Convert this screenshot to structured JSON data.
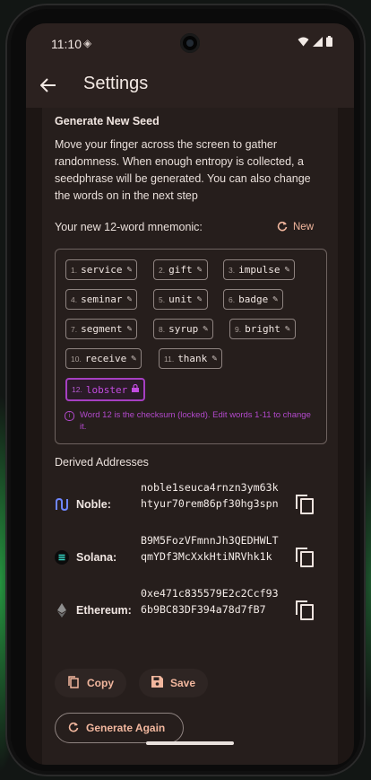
{
  "status_bar": {
    "time": "11:10"
  },
  "app_bar": {
    "title": "Settings"
  },
  "seed": {
    "heading": "Generate New Seed",
    "description": "Move your finger across the screen to gather randomness. When enough entropy is collected, a seedphrase will be generated. You can also change the words on in the next step",
    "mnemonic_label": "Your new 12-word mnemonic:",
    "new_label": "New",
    "words": [
      {
        "n": "1.",
        "w": "service"
      },
      {
        "n": "2.",
        "w": "gift"
      },
      {
        "n": "3.",
        "w": "impulse"
      },
      {
        "n": "4.",
        "w": "seminar"
      },
      {
        "n": "5.",
        "w": "unit"
      },
      {
        "n": "6.",
        "w": "badge"
      },
      {
        "n": "7.",
        "w": "segment"
      },
      {
        "n": "8.",
        "w": "syrup"
      },
      {
        "n": "9.",
        "w": "bright"
      },
      {
        "n": "10.",
        "w": "receive"
      },
      {
        "n": "11.",
        "w": "thank"
      },
      {
        "n": "12.",
        "w": "lobster"
      }
    ],
    "checksum_note": "Word 12 is the checksum (locked). Edit words 1-11 to change it."
  },
  "derived": {
    "heading": "Derived Addresses",
    "addresses": [
      {
        "label": "Noble:",
        "value": "noble1seuca4rnzn3ym63khtyur70rem86pf30hg3spn"
      },
      {
        "label": "Solana:",
        "value": "B9M5FozVFmnnJh3QEDHWLTqmYDf3McXxkHtiNRVhk1k"
      },
      {
        "label": "Ethereum:",
        "value": "0xe471c835579E2c2Ccf936b9BC83DF394a78d7fB7"
      }
    ]
  },
  "actions": {
    "copy": "Copy",
    "save": "Save",
    "generate_again": "Generate Again"
  },
  "colors": {
    "accent": "#f2b79e",
    "locked": "#b249cc",
    "surface": "#261e1c"
  },
  "icons": [
    "back-arrow-icon",
    "refresh-icon",
    "edit-icon",
    "lock-icon",
    "info-icon",
    "noble-icon",
    "solana-icon",
    "ethereum-icon",
    "copy-icon",
    "save-icon"
  ]
}
